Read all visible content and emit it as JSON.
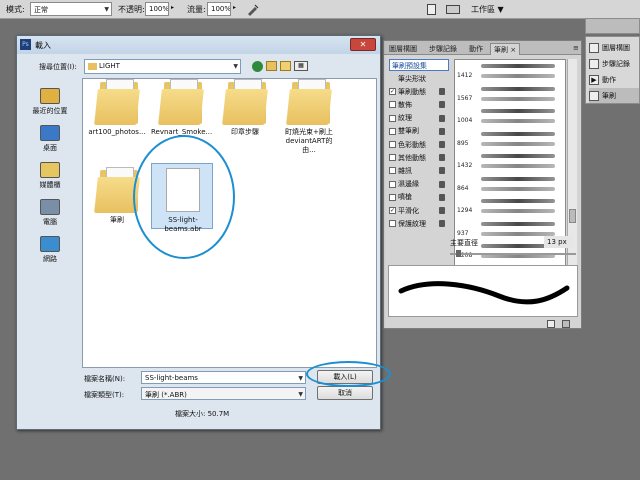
{
  "options_bar": {
    "mode_label": "模式:",
    "mode_value": "正常",
    "opacity_label": "不透明:",
    "opacity_value": "100%",
    "flow_label": "流量:",
    "flow_value": "100%",
    "workspace_label": "工作區"
  },
  "right_dock": {
    "items": [
      {
        "label": "圖層構圖",
        "icon": "layer-comps-icon"
      },
      {
        "label": "步驟記錄",
        "icon": "history-icon"
      },
      {
        "label": "動作",
        "icon": "actions-icon"
      },
      {
        "label": "筆刷",
        "icon": "brush-icon"
      }
    ]
  },
  "brush_panel": {
    "tabs": [
      "圖層構圖",
      "步驟記錄",
      "動作",
      "筆刷"
    ],
    "presets_label": "筆刷預設集",
    "settings": [
      {
        "label": "筆尖形狀",
        "checked": false,
        "lock": false
      },
      {
        "label": "筆刷動態",
        "checked": true,
        "lock": true
      },
      {
        "label": "散佈",
        "checked": false,
        "lock": true
      },
      {
        "label": "紋理",
        "checked": false,
        "lock": true
      },
      {
        "label": "雙筆刷",
        "checked": false,
        "lock": true
      },
      {
        "label": "色彩動態",
        "checked": false,
        "lock": true
      },
      {
        "label": "其他動態",
        "checked": false,
        "lock": true
      },
      {
        "label": "雜訊",
        "checked": false,
        "lock": true
      },
      {
        "label": "濕邊緣",
        "checked": false,
        "lock": true
      },
      {
        "label": "噴槍",
        "checked": false,
        "lock": true
      },
      {
        "label": "平滑化",
        "checked": true,
        "lock": true
      },
      {
        "label": "保護紋理",
        "checked": false,
        "lock": true
      }
    ],
    "tip_sizes": [
      "1412",
      "1567",
      "1004",
      "895",
      "1432",
      "864",
      "1294",
      "937",
      "1208"
    ],
    "diameter_label": "主要直徑",
    "diameter_value": "13 px"
  },
  "dialog": {
    "title": "載入",
    "look_in_label": "搜尋位置(I):",
    "look_in_value": "LIGHT",
    "places": [
      {
        "label": "最近的位置",
        "icon": "recent-places-icon",
        "color": "#e0b040"
      },
      {
        "label": "桌面",
        "icon": "desktop-icon",
        "color": "#3a78c8"
      },
      {
        "label": "媒體櫃",
        "icon": "libraries-icon",
        "color": "#e6c660"
      },
      {
        "label": "電腦",
        "icon": "computer-icon",
        "color": "#7a8ea8"
      },
      {
        "label": "網路",
        "icon": "network-icon",
        "color": "#3a8ed0"
      }
    ],
    "files": [
      {
        "name": "art100_photos...",
        "kind": "folder"
      },
      {
        "name": "Revnart_Smoke...",
        "kind": "folder"
      },
      {
        "name": "印章步驟",
        "kind": "folder"
      },
      {
        "name": "町燒光束+刷上deviantART的由...",
        "kind": "folder"
      },
      {
        "name": "筆刷",
        "kind": "folder"
      }
    ],
    "selected_file": "SS-light-beams.abr",
    "filename_label": "檔案名稱(N):",
    "filename_value": "SS-light-beams",
    "filetype_label": "檔案類型(T):",
    "filetype_value": "筆刷 (*.ABR)",
    "load_button": "載入(L)",
    "cancel_button": "取消",
    "file_size": "檔案大小: 50.7M"
  }
}
